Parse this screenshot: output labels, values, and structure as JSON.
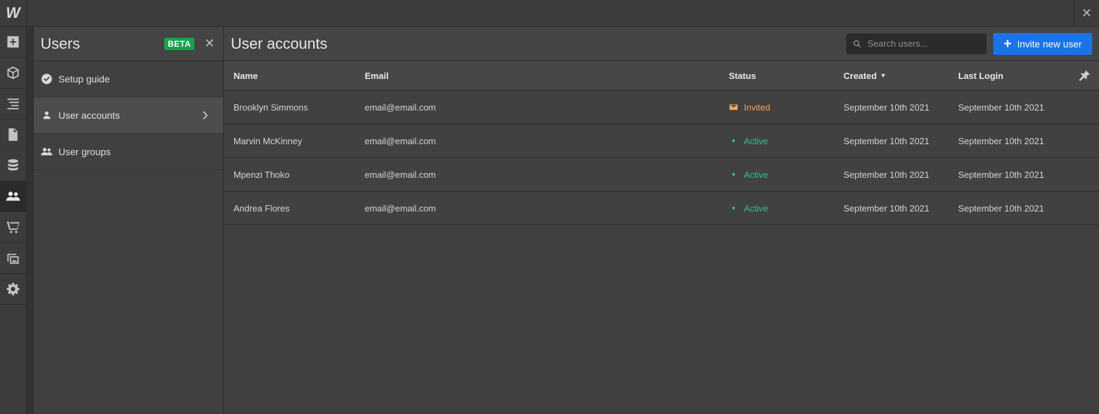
{
  "app": {
    "logo": "W",
    "close_symbol": "✕"
  },
  "rail": {
    "items": [
      {
        "icon": "add-icon"
      },
      {
        "icon": "box-icon"
      },
      {
        "icon": "navigator-icon"
      },
      {
        "icon": "pages-icon"
      },
      {
        "icon": "database-icon"
      },
      {
        "icon": "users-icon",
        "active": true
      },
      {
        "icon": "cart-icon"
      },
      {
        "icon": "assets-icon"
      },
      {
        "icon": "gear-icon"
      }
    ]
  },
  "panel": {
    "title": "Users",
    "badge": "BETA",
    "close_symbol": "✕",
    "items": [
      {
        "label": "Setup guide",
        "icon": "check-circle-icon"
      },
      {
        "label": "User accounts",
        "icon": "user-icon",
        "active": true
      },
      {
        "label": "User groups",
        "icon": "user-group-icon"
      }
    ]
  },
  "main": {
    "title": "User accounts",
    "search": {
      "placeholder": "Search users..."
    },
    "invite_label": "Invite new user",
    "columns": {
      "name": "Name",
      "email": "Email",
      "status": "Status",
      "created": "Created",
      "last_login": "Last Login"
    },
    "rows": [
      {
        "name": "Brooklyn Simmons",
        "email": "email@email.com",
        "status": "Invited",
        "created": "September 10th 2021",
        "last_login": "September 10th 2021"
      },
      {
        "name": "Marvin McKinney",
        "email": "email@email.com",
        "status": "Active",
        "created": "September 10th 2021",
        "last_login": "September 10th 2021"
      },
      {
        "name": "Mpenzi Thoko",
        "email": "email@email.com",
        "status": "Active",
        "created": "September 10th 2021",
        "last_login": "September 10th 2021"
      },
      {
        "name": "Andrea Flores",
        "email": "email@email.com",
        "status": "Active",
        "created": "September 10th 2021",
        "last_login": "September 10th 2021"
      }
    ]
  },
  "colors": {
    "accent": "#1a73e8",
    "beta_badge": "#14a44d",
    "invited": "#f0a45a",
    "active": "#2ec27e"
  }
}
